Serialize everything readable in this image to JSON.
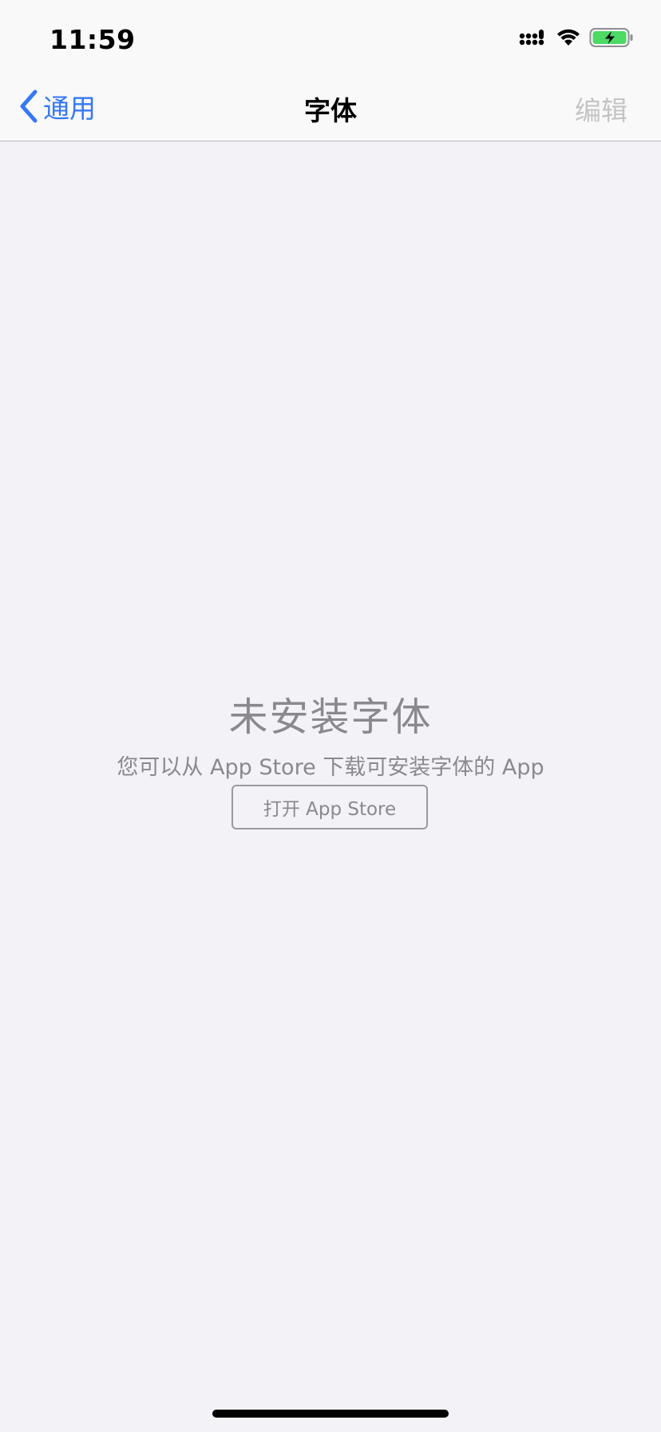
{
  "status_bar": {
    "time": "11:59",
    "icons": [
      "cellular-signal-icon",
      "wifi-icon",
      "battery-charging-icon"
    ],
    "battery_color": "#4cd964"
  },
  "nav": {
    "back_label": "通用",
    "title": "字体",
    "edit_label": "编辑"
  },
  "empty_state": {
    "title": "未安装字体",
    "subtitle": "您可以从 App Store 下载可安装字体的 App",
    "button_label": "打开 App Store"
  },
  "colors": {
    "accent": "#3478f6",
    "background": "#f2f2f7",
    "secondary_text": "#8a8a8e",
    "disabled_text": "#c4c4c6"
  }
}
